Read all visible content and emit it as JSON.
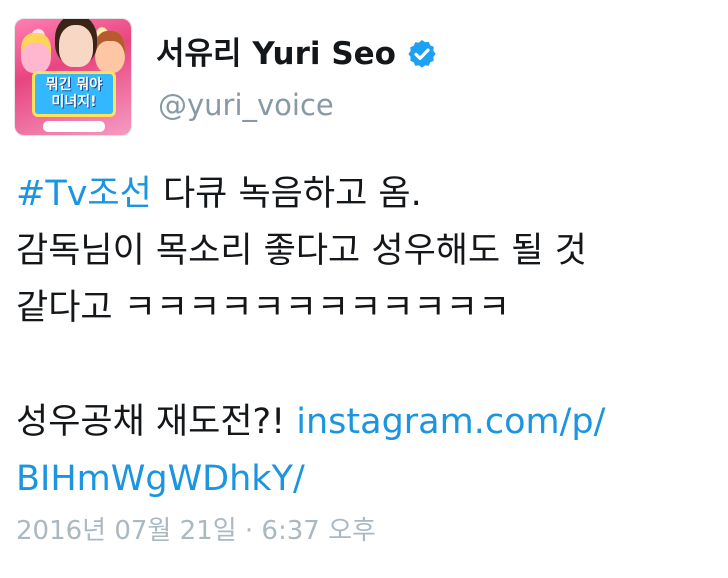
{
  "author": {
    "display_name": "서유리 Yuri Seo",
    "handle": "@yuri_voice",
    "verified": true,
    "avatar": {
      "game_line1": "뭐긴 뭐야",
      "game_line2": "미녀지!"
    }
  },
  "tweet": {
    "hashtag": "#Tv조선",
    "line1_rest": " 다큐 녹음하고 옴.",
    "line2": "감독님이 목소리 좋다고 성우해도 될 것",
    "line3": "같다고 ㅋㅋㅋㅋㅋㅋㅋㅋㅋㅋㅋㅋ",
    "line5_text": "성우공채 재도전?! ",
    "link_part1": "instagram.com/p/",
    "link_part2": "BIHmWgWDhkY/"
  },
  "timestamp": "2016년 07월 21일 · 6:37 오후",
  "colors": {
    "link": "#1b95e0",
    "secondary_text": "#8899a6",
    "timestamp_text": "#aab8c2",
    "verified_badge": "#1da1f2"
  }
}
